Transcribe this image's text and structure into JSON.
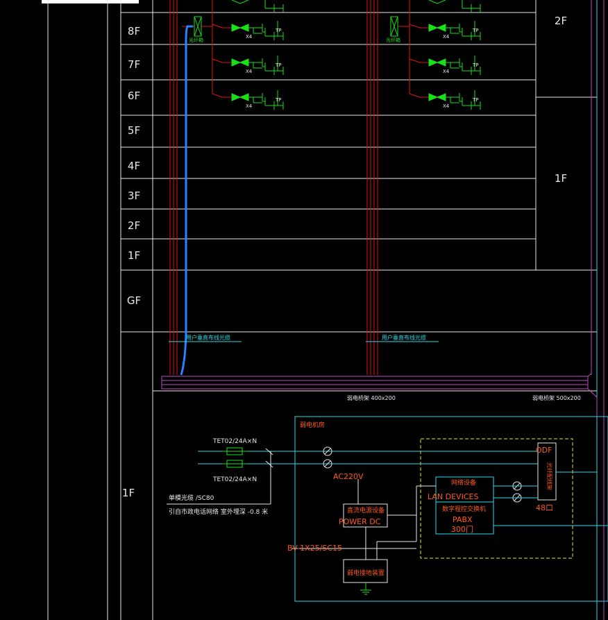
{
  "floors": {
    "upper": [
      "8F",
      "7F",
      "6F",
      "5F",
      "4F",
      "3F",
      "2F",
      "1F",
      "GF"
    ],
    "ground": "1F",
    "right_col": [
      "2F",
      "1F"
    ]
  },
  "labels": {
    "fiber_cabinet": "光纤箱",
    "outlet_x": "X4",
    "outlet_tp": "TP",
    "vertical_cable": "用户垂直布线光缆",
    "tray1": "弱电桥架 400x200",
    "tray2": "弱电桥架 500x200",
    "room_title": "弱电机房",
    "cable_top": "TET02/24A×N",
    "cable_bottom": "TET02/24A×N",
    "single_mode": "单模光缆 /SC80",
    "from_net": "引自市政电话网络    室外埋深 -0.8 米",
    "ac220": "AC220V",
    "dc_cn": "直流电源设备",
    "dc_en": "POWER   DC",
    "bv": "BV-1X25/SC15",
    "ground_cn": "弱电接地装置",
    "net_cn": "网络设备",
    "lan": "LAN DEVICES",
    "pabx_cn": "数字程控交换机",
    "pabx": "PABX",
    "lines": "300门",
    "odf": "ODF",
    "odf_cn": "光纤配线架",
    "odf_count": "48口"
  },
  "colors": {
    "bg": "#000000",
    "grid": "#ffffff",
    "riser": "#e01515",
    "green": "#19e019",
    "cyan": "#2fd9e6",
    "blue": "#2a82ff",
    "magenta": "#c14ac4",
    "orange": "#ff5a1e",
    "yellow": "#e8e02c"
  }
}
